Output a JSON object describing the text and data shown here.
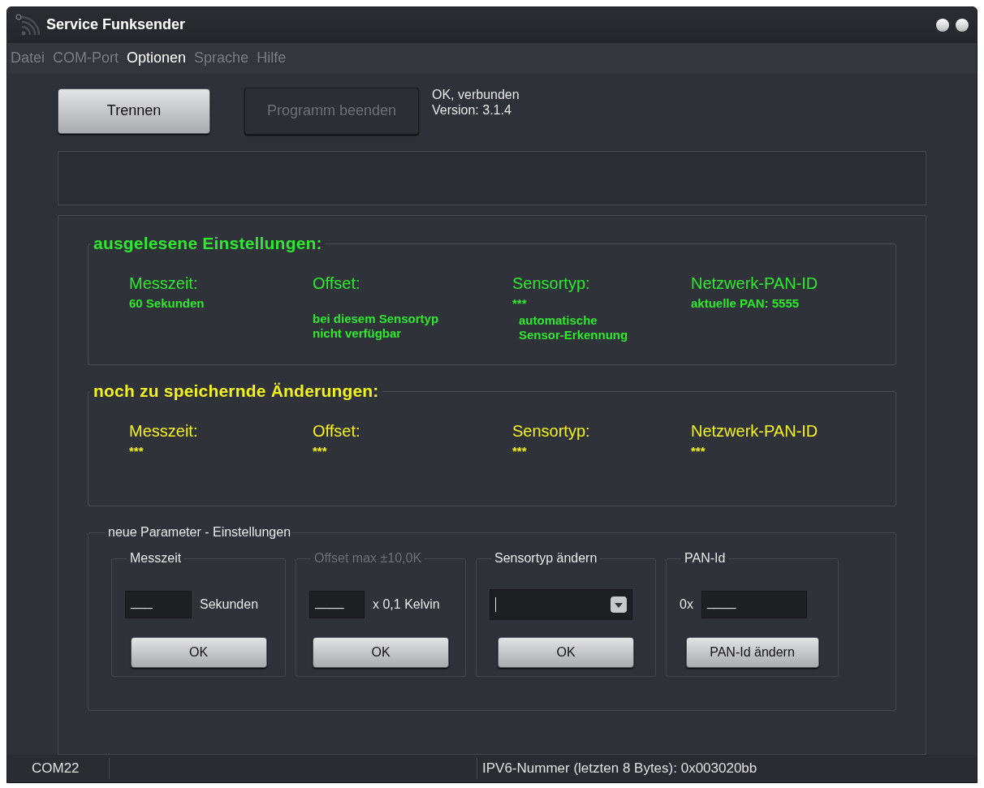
{
  "window": {
    "title": "Service Funksender"
  },
  "menu": [
    {
      "label": "Datei",
      "selected": false
    },
    {
      "label": "COM-Port",
      "selected": false
    },
    {
      "label": "Optionen",
      "selected": true
    },
    {
      "label": "Sprache",
      "selected": false
    },
    {
      "label": "Hilfe",
      "selected": false
    }
  ],
  "buttons": [
    {
      "label": "Trennen",
      "disabled": false
    },
    {
      "label": "Programm beenden",
      "disabled": true
    }
  ],
  "connection_status": [
    "OK, verbunden",
    "Version: 3.1.4"
  ],
  "summary_sections": [
    {
      "title": "ausgelesene Einstellungen:",
      "color": "#2ee82e",
      "columns": [
        {
          "heading": "Messzeit:",
          "value": "60 Sekunden"
        },
        {
          "heading": "Offset:",
          "note": [
            "bei diesem Sensortyp",
            "nicht verfügbar"
          ]
        },
        {
          "heading": "Sensortyp:",
          "value": "***",
          "note": [
            "automatische",
            "Sensor-Erkennung"
          ]
        },
        {
          "heading": "Netzwerk-PAN-ID",
          "value": "aktuelle PAN: 5555"
        }
      ]
    },
    {
      "title": "noch zu speichernde Änderungen:",
      "color": "#f2f21e",
      "columns": [
        {
          "heading": "Messzeit:",
          "value": "***"
        },
        {
          "heading": "Offset:",
          "value": "***"
        },
        {
          "heading": "Sensortyp:",
          "value": "***"
        },
        {
          "heading": "Netzwerk-PAN-ID",
          "value": "***"
        }
      ]
    }
  ],
  "new_parameters": {
    "title": "neue Parameter - Einstellungen",
    "groups": [
      {
        "kind": "number",
        "title": "Messzeit",
        "disabled": false,
        "value": "___",
        "unit": "Sekunden",
        "button": "OK"
      },
      {
        "kind": "number",
        "title": "Offset max ±10,0K",
        "disabled": true,
        "value": "____",
        "unit": "x 0,1 Kelvin",
        "button": "OK"
      },
      {
        "kind": "dropdown",
        "title": "Sensortyp ändern",
        "disabled": false,
        "button": "OK"
      },
      {
        "kind": "hex",
        "title": "PAN-Id",
        "disabled": false,
        "prefix": "0x",
        "value": "____",
        "button": "PAN-Id ändern"
      }
    ]
  },
  "status_bar": [
    "COM22",
    "IPV6-Nummer (letzten 8 Bytes): 0x003020bb"
  ]
}
